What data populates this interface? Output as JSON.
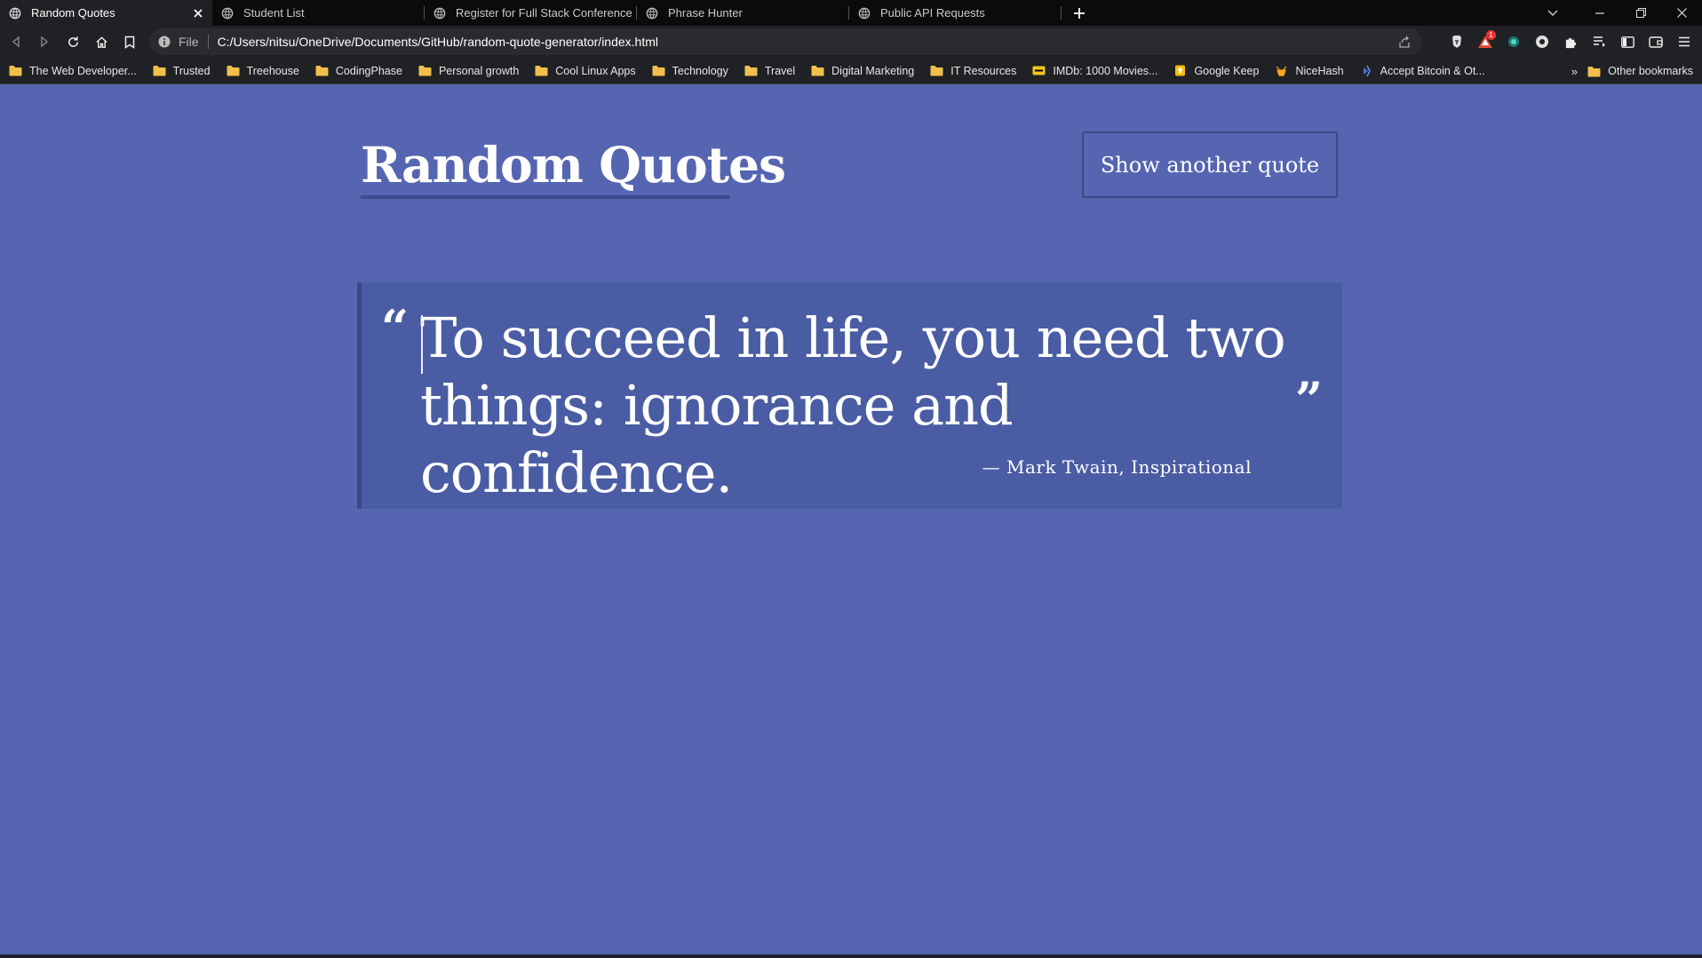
{
  "browser": {
    "tabs": [
      {
        "title": "Random Quotes",
        "active": true
      },
      {
        "title": "Student List",
        "active": false
      },
      {
        "title": "Register for Full Stack Conference",
        "active": false
      },
      {
        "title": "Phrase Hunter",
        "active": false
      },
      {
        "title": "Public API Requests",
        "active": false
      }
    ],
    "address": {
      "scheme": "File",
      "url": "C:/Users/nitsu/OneDrive/Documents/GitHub/random-quote-generator/index.html"
    },
    "extension_badge": "1",
    "bookmarks": [
      {
        "label": "The Web Developer...",
        "icon": "folder-icon"
      },
      {
        "label": "Trusted",
        "icon": "folder-icon"
      },
      {
        "label": "Treehouse",
        "icon": "folder-icon"
      },
      {
        "label": "CodingPhase",
        "icon": "folder-icon"
      },
      {
        "label": "Personal growth",
        "icon": "folder-icon"
      },
      {
        "label": "Cool Linux Apps",
        "icon": "folder-icon"
      },
      {
        "label": "Technology",
        "icon": "folder-icon"
      },
      {
        "label": "Travel",
        "icon": "folder-icon"
      },
      {
        "label": "Digital Marketing",
        "icon": "folder-icon"
      },
      {
        "label": "IT Resources",
        "icon": "folder-icon"
      },
      {
        "label": "IMDb: 1000 Movies...",
        "icon": "imdb-icon"
      },
      {
        "label": "Google Keep",
        "icon": "keep-icon"
      },
      {
        "label": "NiceHash",
        "icon": "nicehash-icon"
      },
      {
        "label": "Accept Bitcoin & Ot...",
        "icon": "bitcoin-icon"
      }
    ],
    "more_bookmarks": "»",
    "other_bookmarks": "Other bookmarks"
  },
  "page": {
    "title": "Random Quotes",
    "button_label": "Show another quote",
    "quote": {
      "open_mark": "“",
      "text": "To succeed in life, you need two things: ignorance and confidence.",
      "close_mark": "”",
      "citation": "— Mark Twain, Inspirational"
    }
  },
  "colors": {
    "page_background": "#5565b1",
    "quote_background": "#4a5ca3",
    "accent_border": "#3b4886",
    "browser_chrome": "#202124",
    "tab_strip": "#0b0b0c"
  }
}
